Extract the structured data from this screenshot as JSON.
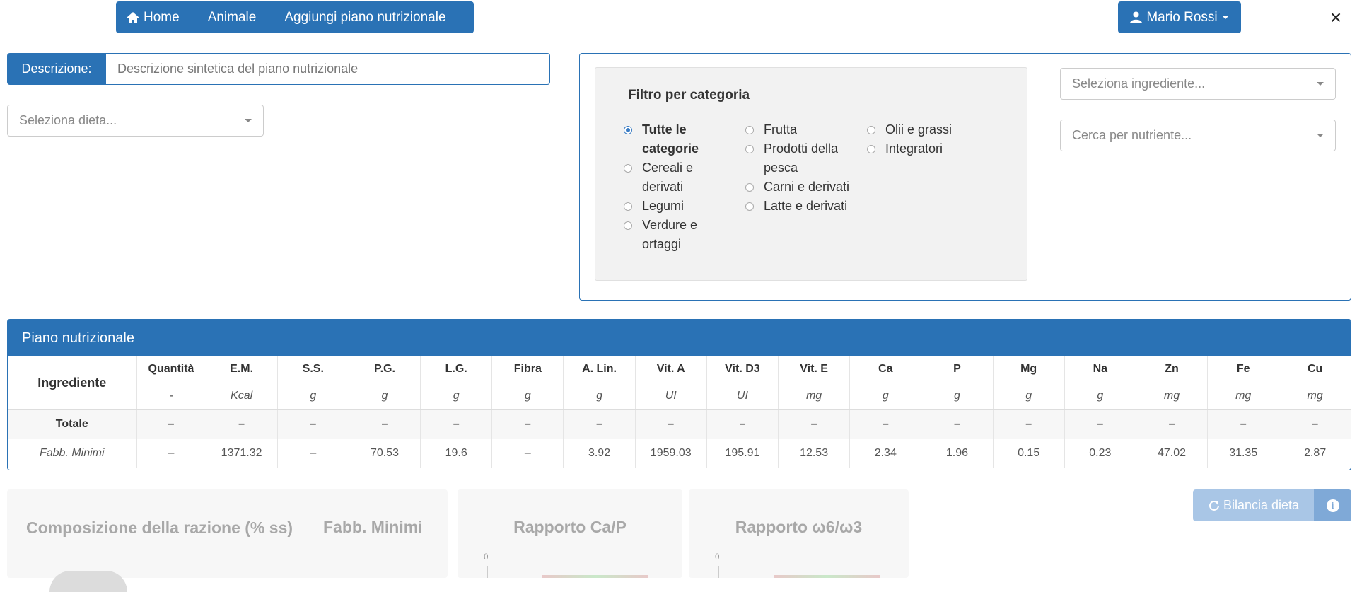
{
  "nav": {
    "home": "Home",
    "animale": "Animale",
    "aggiungi": "Aggiungi piano nutrizionale",
    "user": "Mario Rossi",
    "close": "×"
  },
  "description": {
    "label": "Descrizione:",
    "placeholder": "Descrizione sintetica del piano nutrizionale"
  },
  "diet_select": {
    "placeholder": "Seleziona dieta..."
  },
  "filter": {
    "title": "Filtro per categoria",
    "columns": [
      [
        {
          "label": "Tutte le categorie",
          "selected": true
        },
        {
          "label": "Cereali e derivati",
          "selected": false
        },
        {
          "label": "Legumi",
          "selected": false
        },
        {
          "label": "Verdure e ortaggi",
          "selected": false
        }
      ],
      [
        {
          "label": "Frutta",
          "selected": false
        },
        {
          "label": "Prodotti della pesca",
          "selected": false
        },
        {
          "label": "Carni e derivati",
          "selected": false
        },
        {
          "label": "Latte e derivati",
          "selected": false
        }
      ],
      [
        {
          "label": "Olii e grassi",
          "selected": false
        },
        {
          "label": "Integratori",
          "selected": false
        }
      ]
    ],
    "ingredient_select": "Seleziona ingrediente...",
    "nutrient_select": "Cerca per nutriente..."
  },
  "plan": {
    "title": "Piano nutrizionale",
    "ingredient_header": "Ingrediente",
    "columns": [
      "Quantità",
      "E.M.",
      "S.S.",
      "P.G.",
      "L.G.",
      "Fibra",
      "A. Lin.",
      "Vit. A",
      "Vit. D3",
      "Vit. E",
      "Ca",
      "P",
      "Mg",
      "Na",
      "Zn",
      "Fe",
      "Cu"
    ],
    "units": [
      "-",
      "Kcal",
      "g",
      "g",
      "g",
      "g",
      "g",
      "UI",
      "UI",
      "mg",
      "g",
      "g",
      "g",
      "g",
      "mg",
      "mg",
      "mg"
    ],
    "total_label": "Totale",
    "totals": [
      "–",
      "–",
      "–",
      "–",
      "–",
      "–",
      "–",
      "–",
      "–",
      "–",
      "–",
      "–",
      "–",
      "–",
      "–",
      "–",
      "–"
    ],
    "fabb_label": "Fabb. Minimi",
    "fabb": [
      "–",
      "1371.32",
      "–",
      "70.53",
      "19.6",
      "–",
      "3.92",
      "1959.03",
      "195.91",
      "12.53",
      "2.34",
      "1.96",
      "0.15",
      "0.23",
      "47.02",
      "31.35",
      "2.87"
    ]
  },
  "cards": {
    "composition": "Composizione della razione (% ss)",
    "fabb_minimi": "Fabb. Minimi",
    "ratio_cap": "Rapporto Ca/P",
    "ratio_omega": "Rapporto ω6/ω3",
    "axis_zero": "0"
  },
  "balance": {
    "label": "Bilancia dieta",
    "info": "i"
  },
  "colors": {
    "primary": "#2a72b5",
    "disabled_button": "#a9c6e6"
  }
}
